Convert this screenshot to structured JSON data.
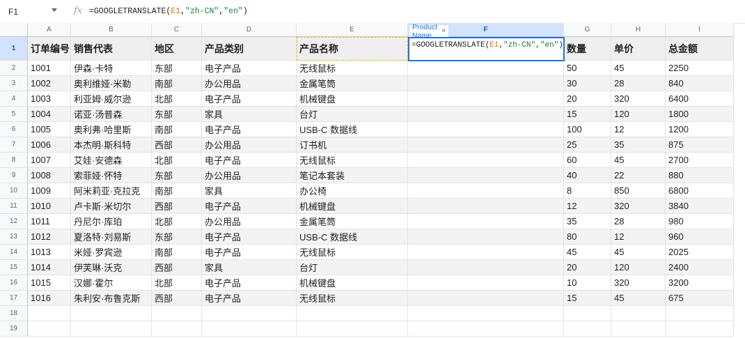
{
  "formula_bar": {
    "name_box": "F1",
    "fx_label": "fx",
    "formula_parts": [
      "=GOOGLETRANSLATE(",
      "E1",
      ",",
      "\"zh-CN\"",
      ",",
      "\"en\"",
      ")"
    ]
  },
  "columns": [
    "A",
    "B",
    "C",
    "D",
    "E",
    "F",
    "G",
    "H",
    "I"
  ],
  "selected_column": "F",
  "selected_row": 1,
  "active_cell_text": {
    "prefix": "=GOOGLETRANSLATE(",
    "ref": "E1",
    "sep1": ",",
    "lang_from": "\"zh-CN\"",
    "sep2": ",",
    "lang_to": "\"en\"",
    "suffix": ")"
  },
  "formula_chip": {
    "label": "Product Name",
    "close": "×"
  },
  "header_row": [
    "订单编号",
    "销售代表",
    "地区",
    "产品类别",
    "产品名称",
    "",
    "数量",
    "单价",
    "总金额"
  ],
  "rows": [
    [
      "1001",
      "伊森·卡特",
      "东部",
      "电子产品",
      "无线鼠标",
      "",
      "50",
      "45",
      "2250"
    ],
    [
      "1002",
      "奥利维娅·米勒",
      "南部",
      "办公用品",
      "金属笔筒",
      "",
      "30",
      "28",
      "840"
    ],
    [
      "1003",
      "利亚姆·威尔逊",
      "北部",
      "电子产品",
      "机械键盘",
      "",
      "20",
      "320",
      "6400"
    ],
    [
      "1004",
      "诺亚·汤普森",
      "东部",
      "家具",
      "台灯",
      "",
      "15",
      "120",
      "1800"
    ],
    [
      "1005",
      "奥利弗·哈里斯",
      "南部",
      "电子产品",
      "USB-C 数据线",
      "",
      "100",
      "12",
      "1200"
    ],
    [
      "1006",
      "本杰明·斯科特",
      "西部",
      "办公用品",
      "订书机",
      "",
      "25",
      "35",
      "875"
    ],
    [
      "1007",
      "艾娃·安德森",
      "北部",
      "电子产品",
      "无线鼠标",
      "",
      "60",
      "45",
      "2700"
    ],
    [
      "1008",
      "索菲娅·怀特",
      "东部",
      "办公用品",
      "笔记本套装",
      "",
      "40",
      "22",
      "880"
    ],
    [
      "1009",
      "阿米莉亚·克拉克",
      "南部",
      "家具",
      "办公椅",
      "",
      "8",
      "850",
      "6800"
    ],
    [
      "1010",
      "卢卡斯·米切尔",
      "西部",
      "电子产品",
      "机械键盘",
      "",
      "12",
      "320",
      "3840"
    ],
    [
      "1011",
      "丹尼尔·库珀",
      "北部",
      "办公用品",
      "金属笔筒",
      "",
      "35",
      "28",
      "980"
    ],
    [
      "1012",
      "夏洛特·刘易斯",
      "东部",
      "电子产品",
      "USB-C 数据线",
      "",
      "80",
      "12",
      "960"
    ],
    [
      "1013",
      "米娅·罗宾逊",
      "南部",
      "电子产品",
      "无线鼠标",
      "",
      "45",
      "45",
      "2025"
    ],
    [
      "1014",
      "伊芙琳·沃克",
      "西部",
      "家具",
      "台灯",
      "",
      "20",
      "120",
      "2400"
    ],
    [
      "1015",
      "汉娜·霍尔",
      "北部",
      "电子产品",
      "机械键盘",
      "",
      "10",
      "320",
      "3200"
    ],
    [
      "1016",
      "朱利安·布鲁克斯",
      "西部",
      "电子产品",
      "无线鼠标",
      "",
      "15",
      "45",
      "675"
    ]
  ],
  "empty_row_numbers": [
    "18",
    "19"
  ]
}
